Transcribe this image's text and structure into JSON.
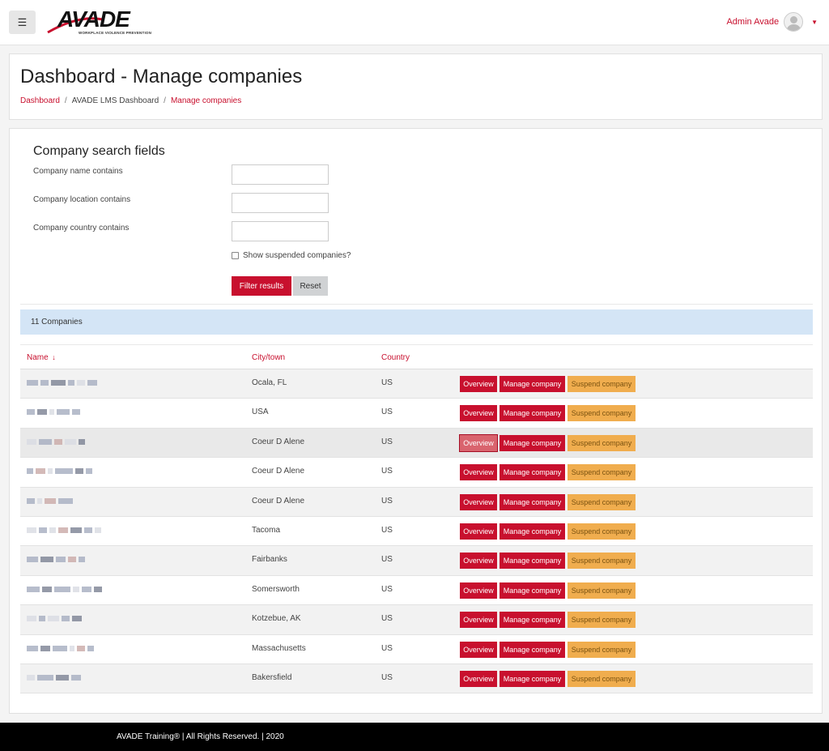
{
  "header": {
    "logo_text": "AVADE",
    "logo_tagline": "WORKPLACE VIOLENCE PREVENTION",
    "user_name": "Admin Avade"
  },
  "page": {
    "title": "Dashboard - Manage companies",
    "breadcrumb": [
      "Dashboard",
      "AVADE LMS Dashboard",
      "Manage companies"
    ]
  },
  "search": {
    "title": "Company search fields",
    "name_label": "Company name contains",
    "location_label": "Company location contains",
    "country_label": "Company country contains",
    "name_value": "",
    "location_value": "",
    "country_value": "",
    "show_suspended_label": "Show suspended companies?",
    "filter_label": "Filter results",
    "reset_label": "Reset"
  },
  "results": {
    "count_label": "11 Companies",
    "columns": {
      "name": "Name",
      "city": "City/town",
      "country": "Country"
    },
    "action_labels": {
      "overview": "Overview",
      "manage": "Manage company",
      "suspend": "Suspend company"
    },
    "rows": [
      {
        "city": "Ocala, FL",
        "country": "US"
      },
      {
        "city": "USA",
        "country": "US"
      },
      {
        "city": "Coeur D Alene",
        "country": "US"
      },
      {
        "city": "Coeur D Alene",
        "country": "US"
      },
      {
        "city": "Coeur D Alene",
        "country": "US"
      },
      {
        "city": "Tacoma",
        "country": "US"
      },
      {
        "city": "Fairbanks",
        "country": "US"
      },
      {
        "city": "Somersworth",
        "country": "US"
      },
      {
        "city": "Kotzebue, AK",
        "country": "US"
      },
      {
        "city": "Massachusetts",
        "country": "US"
      },
      {
        "city": "Bakersfield",
        "country": "US"
      }
    ]
  },
  "footer": {
    "text": "AVADE Training® | All Rights Reserved. | 2020"
  },
  "colors": {
    "accent": "#c8102e",
    "warning": "#f0ad4e",
    "info_bar": "#d4e5f6"
  }
}
